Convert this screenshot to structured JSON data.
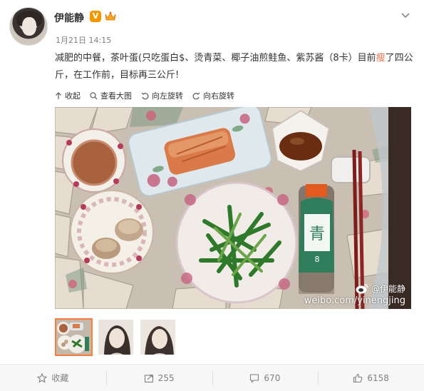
{
  "user": {
    "name": "伊能静",
    "verified_badge": "V",
    "time": "1月21日 14:15"
  },
  "post": {
    "text_part1": "减肥的中餐，茶叶蛋(只吃蛋白$、烫青菜、椰子油煎鲑鱼、紫苏酱（8卡）目前",
    "text_highlight": "瘦",
    "text_part2": "了四公斤，在工作前，目标再三公斤!"
  },
  "toolbar": {
    "collapse": "收起",
    "view_large": "查看大图",
    "rotate_left": "向左旋转",
    "rotate_right": "向右旋转"
  },
  "image": {
    "watermark_name": "@伊能静",
    "watermark_url": "weibo.com/yinengjing",
    "bottle_label": "青",
    "bottle_number": "8"
  },
  "thumbnails": [
    {
      "label": "thumbnail-1",
      "active": true
    },
    {
      "label": "thumbnail-2",
      "active": false
    },
    {
      "label": "thumbnail-3",
      "active": false
    }
  ],
  "actions": {
    "favorite": "收藏",
    "repost": "255",
    "comment": "670",
    "like": "6158"
  },
  "colors": {
    "accent": "#eb7350",
    "badge": "#f39800",
    "thumb_active": "#fa7d3c"
  }
}
